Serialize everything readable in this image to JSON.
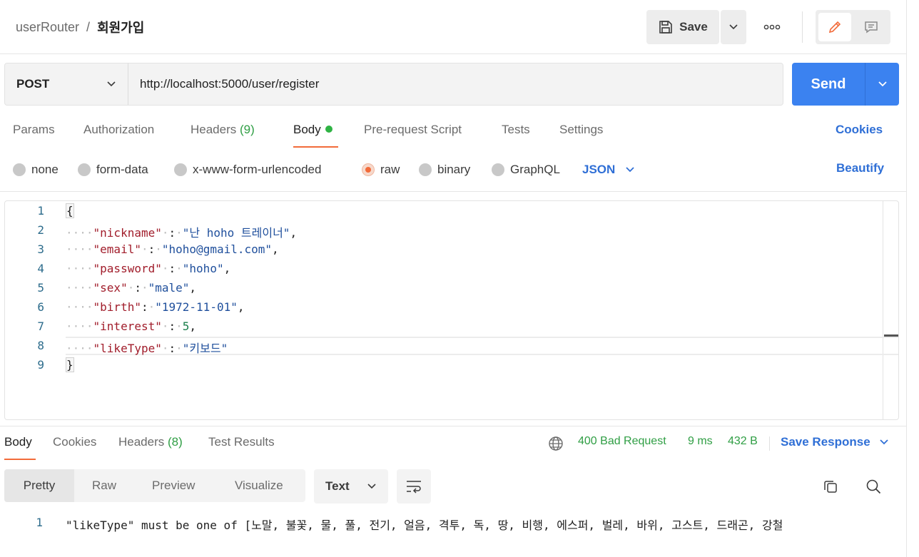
{
  "header": {
    "collection": "userRouter",
    "separator": "/",
    "request_name": "회원가입",
    "save_label": "Save"
  },
  "request": {
    "method": "POST",
    "url": "http://localhost:5000/user/register",
    "send_label": "Send"
  },
  "tabs": {
    "params": "Params",
    "authorization": "Authorization",
    "headers": "Headers",
    "headers_count": "(9)",
    "body": "Body",
    "prerequest": "Pre-request Script",
    "tests": "Tests",
    "settings": "Settings",
    "cookies": "Cookies"
  },
  "body_types": {
    "none": "none",
    "form_data": "form-data",
    "urlencoded": "x-www-form-urlencoded",
    "raw": "raw",
    "binary": "binary",
    "graphql": "GraphQL",
    "language": "JSON",
    "beautify": "Beautify",
    "selected": "raw"
  },
  "editor": {
    "line_numbers": [
      "1",
      "2",
      "3",
      "4",
      "5",
      "6",
      "7",
      "8",
      "9"
    ],
    "open_brace": "{",
    "close_brace": "}",
    "fields": [
      {
        "key": "\"nickname\"",
        "value": "\"난 hoho 트레이너\"",
        "trail": ","
      },
      {
        "key": "\"email\"",
        "value": "\"hoho@gmail.com\"",
        "trail": ","
      },
      {
        "key": "\"password\"",
        "value": "\"hoho\"",
        "trail": ","
      },
      {
        "key": "\"sex\"",
        "value": "\"male\"",
        "trail": ","
      },
      {
        "key": "\"birth\"",
        "value": "\"1972-11-01\"",
        "trail": ","
      },
      {
        "key": "\"interest\"",
        "value": "5",
        "trail": ","
      },
      {
        "key": "\"likeType\"",
        "value": "\"키보드\"",
        "trail": ""
      }
    ]
  },
  "response": {
    "tabs": {
      "body": "Body",
      "cookies": "Cookies",
      "headers": "Headers",
      "headers_count": "(8)",
      "test_results": "Test Results"
    },
    "status": "400 Bad Request",
    "time": "9 ms",
    "size": "432 B",
    "save_response": "Save Response",
    "views": {
      "pretty": "Pretty",
      "raw": "Raw",
      "preview": "Preview",
      "visualize": "Visualize"
    },
    "format": "Text",
    "line_number": "1",
    "body_text": "\"likeType\" must be one of [노말, 불꽃, 물, 풀, 전기, 얼음, 격투, 독, 땅, 비행, 에스퍼, 벌레, 바위, 고스트, 드래곤, 강철"
  },
  "colors": {
    "accent": "#f26b3a",
    "send_blue": "#3b82f0",
    "link_blue": "#2f6fd6",
    "status_green": "#2f9e44"
  }
}
